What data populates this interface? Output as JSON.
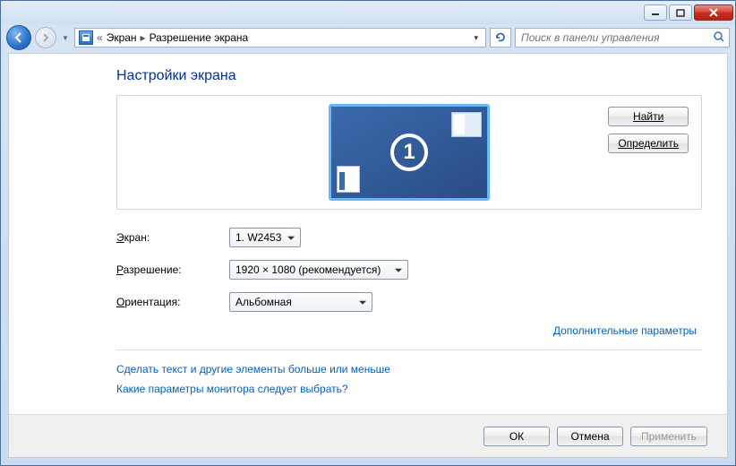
{
  "titlebar": {},
  "breadcrumb": {
    "item1": "Экран",
    "item2": "Разрешение экрана"
  },
  "search": {
    "placeholder": "Поиск в панели управления"
  },
  "heading": "Настройки экрана",
  "display_number": "1",
  "buttons": {
    "find": "Найти",
    "detect": "Определить",
    "ok": "ОК",
    "cancel": "Отмена",
    "apply": "Применить"
  },
  "labels": {
    "screen_pre": "Э",
    "screen_post": "кран:",
    "resolution_pre": "Р",
    "resolution_post": "азрешение:",
    "orientation_pre": "О",
    "orientation_post": "риентация:"
  },
  "values": {
    "screen": "1. W2453",
    "resolution": "1920 × 1080 (рекомендуется)",
    "orientation": "Альбомная"
  },
  "links": {
    "advanced": "Дополнительные параметры",
    "text_size": "Сделать текст и другие элементы больше или меньше",
    "which_settings": "Какие параметры монитора следует выбрать?"
  }
}
